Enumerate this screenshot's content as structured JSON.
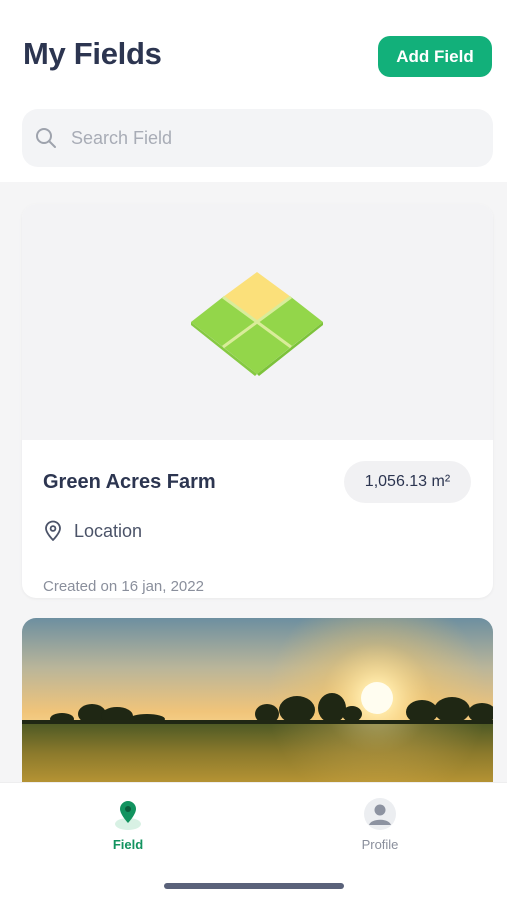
{
  "header": {
    "title": "My Fields",
    "add_button_label": "Add Field"
  },
  "search": {
    "placeholder": "Search Field",
    "icon": "search-icon"
  },
  "fields": [
    {
      "name": "Green Acres Farm",
      "area": "1,056.13 m²",
      "location": "Location",
      "created": "Created on 16 jan, 2022",
      "thumbnail": "field-plot-graphic"
    },
    {
      "thumbnail": "wheat-field-sunset-photo"
    }
  ],
  "tabbar": {
    "tabs": [
      {
        "label": "Field",
        "icon": "map-pin-icon",
        "active": true
      },
      {
        "label": "Profile",
        "icon": "user-avatar-icon",
        "active": false
      }
    ]
  },
  "colors": {
    "accent": "#12b07a",
    "title": "#2c3550",
    "field_green": "#93d64a",
    "field_yellow": "#fbe07a"
  }
}
